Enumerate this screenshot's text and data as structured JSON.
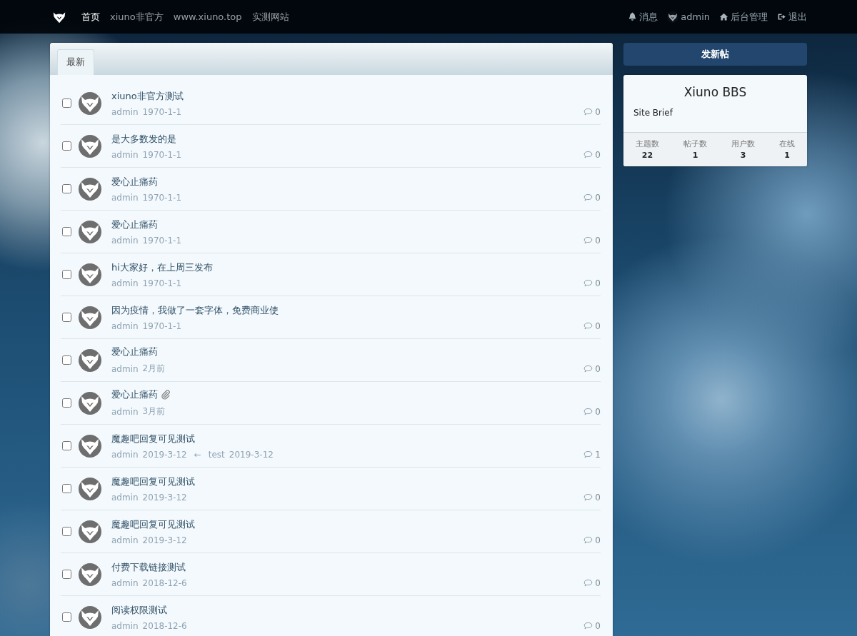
{
  "navbar": {
    "links": [
      {
        "label": "首页",
        "selected": true
      },
      {
        "label": "xiuno非官方",
        "selected": false
      },
      {
        "label": "www.xiuno.top",
        "selected": false
      },
      {
        "label": "实测网站",
        "selected": false
      }
    ],
    "right": [
      {
        "kind": "bell",
        "label": "消息"
      },
      {
        "kind": "avatar",
        "label": "admin"
      },
      {
        "kind": "home",
        "label": "后台管理"
      },
      {
        "kind": "logout",
        "label": "退出"
      }
    ]
  },
  "tabs": [
    {
      "label": "最新",
      "selected": true
    }
  ],
  "threads": [
    {
      "title": "xiuno非官方测试",
      "author": "admin",
      "date": "1970-1-1",
      "replies": "0",
      "checked": false
    },
    {
      "title": "是大多数发的是",
      "author": "admin",
      "date": "1970-1-1",
      "replies": "0",
      "checked": false
    },
    {
      "title": "爱心止痛药",
      "author": "admin",
      "date": "1970-1-1",
      "replies": "0",
      "checked": false
    },
    {
      "title": "爱心止痛药",
      "author": "admin",
      "date": "1970-1-1",
      "replies": "0",
      "checked": false
    },
    {
      "title": "hi大家好，在上周三发布",
      "author": "admin",
      "date": "1970-1-1",
      "replies": "0",
      "checked": false
    },
    {
      "title": "因为疫情，我做了一套字体，免费商业使",
      "author": "admin",
      "date": "1970-1-1",
      "replies": "0",
      "checked": false
    },
    {
      "title": "爱心止痛药",
      "author": "admin",
      "date": "2月前",
      "replies": "0",
      "checked": false
    },
    {
      "title": "爱心止痛药",
      "author": "admin",
      "date": "3月前",
      "replies": "0",
      "checked": false,
      "attachment": true
    },
    {
      "title": "魔趣吧回复可见测试",
      "author": "admin",
      "date": "2019-3-12",
      "replies": "1",
      "checked": false,
      "last_reply": {
        "arrow": "←",
        "user": "test",
        "date": "2019-3-12"
      }
    },
    {
      "title": "魔趣吧回复可见测试",
      "author": "admin",
      "date": "2019-3-12",
      "replies": "0",
      "checked": false
    },
    {
      "title": "魔趣吧回复可见测试",
      "author": "admin",
      "date": "2019-3-12",
      "replies": "0",
      "checked": false
    },
    {
      "title": "付费下载链接测试",
      "author": "admin",
      "date": "2018-12-6",
      "replies": "0",
      "checked": false
    },
    {
      "title": "阅读权限测试",
      "author": "admin",
      "date": "2018-12-6",
      "replies": "0",
      "checked": false
    }
  ],
  "new_thread_button": "发新帖",
  "site_card": {
    "title": "Xiuno BBS",
    "brief": "Site Brief",
    "stats": [
      {
        "label": "主题数",
        "value": "22"
      },
      {
        "label": "帖子数",
        "value": "1"
      },
      {
        "label": "用户数",
        "value": "3"
      },
      {
        "label": "在线",
        "value": "1"
      }
    ]
  }
}
